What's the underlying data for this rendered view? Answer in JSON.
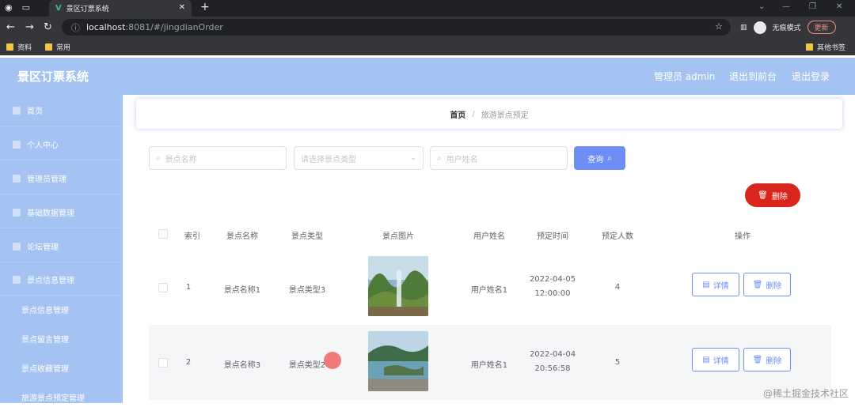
{
  "browser": {
    "tab_title": "景区订票系统",
    "tab_favicon": "V",
    "url_host": "localhost",
    "url_path": ":8081/#/jingdianOrder",
    "incognito_label": "无痕模式",
    "update_label": "更新",
    "bookmarks": [
      "资料",
      "常用"
    ],
    "other_bookmarks": "其他书签"
  },
  "app": {
    "title": "景区订票系统",
    "header_links": [
      "管理员 admin",
      "退出到前台",
      "退出登录"
    ]
  },
  "sidebar": {
    "items": [
      "首页",
      "个人中心",
      "管理员管理",
      "基础数据管理",
      "论坛管理",
      "景点信息管理"
    ],
    "subitems": [
      "景点信息管理",
      "景点留言管理",
      "景点收藏管理",
      "旅游景点预定管理"
    ]
  },
  "breadcrumb": {
    "home": "首页",
    "separator": "/",
    "current": "旅游景点预定"
  },
  "filters": {
    "name_placeholder": "景点名称",
    "type_placeholder": "请选择景点类型",
    "user_placeholder": "用户姓名",
    "query_label": "查询"
  },
  "actions": {
    "delete_label": "删除"
  },
  "table": {
    "headers": [
      "索引",
      "景点名称",
      "景点类型",
      "景点图片",
      "用户姓名",
      "预定时间",
      "预定人数",
      "操作"
    ],
    "rows": [
      {
        "index": "1",
        "name": "景点名称1",
        "type": "景点类型3",
        "user": "用户姓名1",
        "date": "2022-04-05",
        "time": "12:00:00",
        "count": "4"
      },
      {
        "index": "2",
        "name": "景点名称3",
        "type": "景点类型2",
        "user": "用户姓名1",
        "date": "2022-04-04",
        "time": "20:56:58",
        "count": "5"
      }
    ],
    "detail_label": "详情",
    "row_delete_label": "删除"
  },
  "watermark": "@稀土掘金技术社区",
  "colors": {
    "sidebar": "#a4c3f2",
    "primary": "#6f8ef5",
    "danger": "#d9261c"
  }
}
